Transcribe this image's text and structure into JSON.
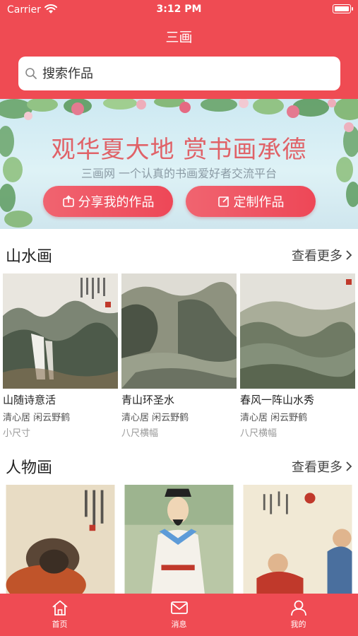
{
  "status_bar": {
    "carrier": "Carrier",
    "time": "3:12 PM"
  },
  "nav": {
    "title": "三画"
  },
  "search": {
    "placeholder": "搜索作品"
  },
  "banner": {
    "headline": "观华夏大地 赏书画承德",
    "subtitle": "三画网 一个认真的书画爱好者交流平台",
    "share_label": "分享我的作品",
    "custom_label": "定制作品"
  },
  "sections": [
    {
      "title": "山水画",
      "more_label": "查看更多",
      "items": [
        {
          "name": "山随诗意活",
          "author": "清心居 闲云野鹤",
          "size": "小尺寸"
        },
        {
          "name": "青山环圣水",
          "author": "清心居 闲云野鹤",
          "size": "八尺横幅"
        },
        {
          "name": "春风一阵山水秀",
          "author": "清心居 闲云野鹤",
          "size": "八尺横幅"
        }
      ]
    },
    {
      "title": "人物画",
      "more_label": "查看更多",
      "items": [
        {},
        {},
        {}
      ]
    }
  ],
  "tabs": [
    {
      "label": "首页",
      "icon": "home-icon"
    },
    {
      "label": "消息",
      "icon": "mail-icon"
    },
    {
      "label": "我的",
      "icon": "user-icon"
    }
  ],
  "colors": {
    "accent": "#ef4b53",
    "banner_text": "#e06268"
  }
}
